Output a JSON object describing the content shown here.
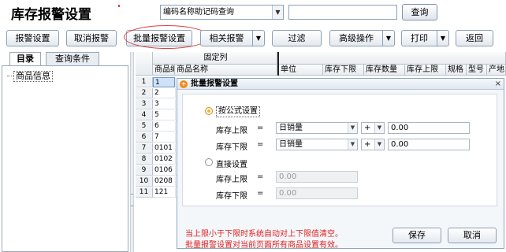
{
  "title": "库存报警设置",
  "search": {
    "combo_value": "编码名称助记码查询",
    "button": "查询"
  },
  "toolbar": {
    "alarm_settings": "报警设置",
    "cancel_alarm": "取消报警",
    "batch_alarm": "批量报警设置",
    "related_alarm": "相关报警",
    "filter": "过滤",
    "advanced": "高级操作",
    "print": "打印",
    "back": "返回"
  },
  "tabs": {
    "catalog": "目录",
    "query": "查询条件"
  },
  "tree": {
    "root": "商品信息"
  },
  "grid": {
    "fixed_header": "固定列",
    "columns": [
      "商品编码",
      "商品名称",
      "单位",
      "库存下限",
      "库存数量",
      "库存上限",
      "规格",
      "型号",
      "产地"
    ],
    "rows": [
      {
        "num": "1",
        "code": "1"
      },
      {
        "num": "2",
        "code": "2"
      },
      {
        "num": "3",
        "code": "3"
      },
      {
        "num": "4",
        "code": "5"
      },
      {
        "num": "5",
        "code": "6"
      },
      {
        "num": "6",
        "code": "7"
      },
      {
        "num": "7",
        "code": "0101"
      },
      {
        "num": "8",
        "code": "0102"
      },
      {
        "num": "9",
        "code": "0106"
      },
      {
        "num": "10",
        "code": "0208"
      },
      {
        "num": "11",
        "code": "121"
      }
    ]
  },
  "dialog": {
    "title": "批量报警设置",
    "close": "×",
    "formula_option": "按公式设置",
    "direct_option": "直接设置",
    "upper_label": "库存上限",
    "lower_label": "库存下限",
    "eq": "=",
    "upper_source": "日销量",
    "lower_source": "日销量",
    "upper_op": "+",
    "lower_op": "+",
    "upper_value": "0.00",
    "lower_value": "0.00",
    "direct_upper_label": "库存上限",
    "direct_lower_label": "库存下限",
    "direct_upper_value": "0.00",
    "direct_lower_value": "0.00",
    "note1": "当上限小于下限时系统自动对上下限值清空。",
    "note2": "批量报警设置对当前页面所有商品设置有效。",
    "save": "保存",
    "cancel": "取消"
  }
}
